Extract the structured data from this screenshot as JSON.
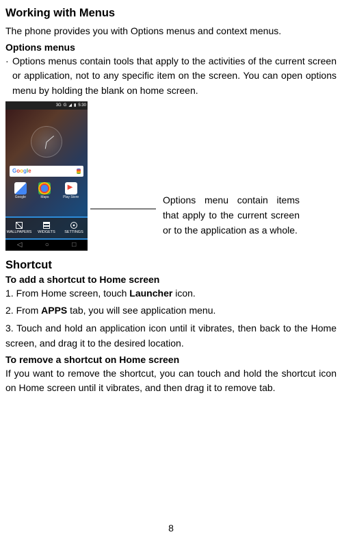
{
  "title": "Working with Menus",
  "intro": "The phone provides you with Options menus and context menus.",
  "section_options_title": "Options menus",
  "bullet_mark": "·",
  "options_bullet": "Options menus contain tools that apply to the activities of the current screen or application, not to any specific item on the screen. You can open options menu by holding the blank on home screen.",
  "screenshot": {
    "status": {
      "net": "3G",
      "net2": "G",
      "sig": "◢",
      "bat": "▮",
      "time": "5:30"
    },
    "apps": [
      {
        "label": "Google"
      },
      {
        "label": "Maps"
      },
      {
        "label": "Play Store"
      }
    ],
    "options_bar": [
      {
        "label": "WALLPAPERS"
      },
      {
        "label": "WIDGETS"
      },
      {
        "label": "SETTINGS"
      }
    ],
    "nav": {
      "back": "◁",
      "home": "○",
      "recent": "□"
    }
  },
  "callout": "Options menu contain items that apply to the current screen or to the application as a whole.",
  "shortcut_title": "Shortcut",
  "add_title": "To add a shortcut to Home screen",
  "step1_a": "1. From Home screen, touch ",
  "step1_b": "Launcher",
  "step1_c": " icon.",
  "step2_a": "2. From ",
  "step2_b": "APPS",
  "step2_c": " tab, you will see application menu.",
  "step3": "3. Touch and hold an application icon until it vibrates, then back to the Home screen, and drag it to the desired location.",
  "remove_title": "To remove a shortcut on Home screen",
  "remove_body": "If you want to remove the shortcut, you can touch and hold the shortcut icon on Home screen until it vibrates, and then drag it to remove tab.",
  "page_number": "8"
}
